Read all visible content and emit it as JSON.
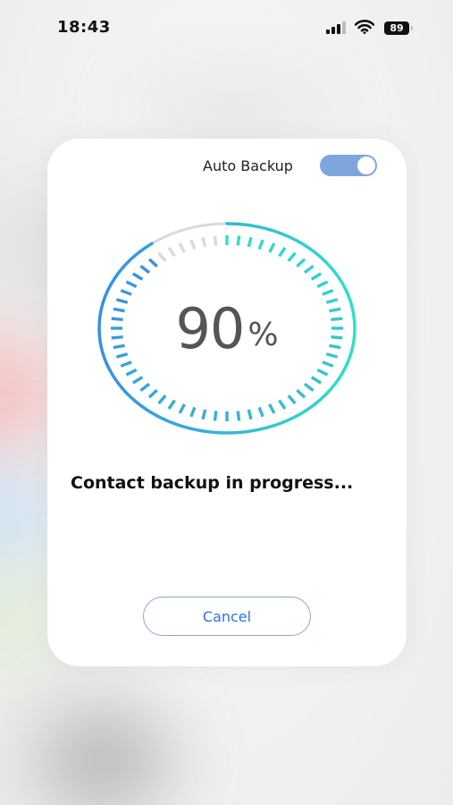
{
  "status_bar": {
    "time": "18:43",
    "battery": "89",
    "icons": [
      "cellular-signal-icon",
      "wifi-icon",
      "battery-icon"
    ]
  },
  "dialog": {
    "auto_backup_label": "Auto Backup",
    "auto_backup_enabled": true,
    "progress_value": "90",
    "progress_unit": "%",
    "progress_fraction": 0.9,
    "message": "Contact backup in progress...",
    "cancel_label": "Cancel"
  },
  "colors": {
    "toggle_on": "#7ea6dc",
    "ring_start": "#3a8ee6",
    "ring_end": "#2ee0c8",
    "ring_remaining": "#d9d9d9",
    "cancel_text": "#2f6fe0",
    "cancel_border": "#8aa5d8"
  }
}
